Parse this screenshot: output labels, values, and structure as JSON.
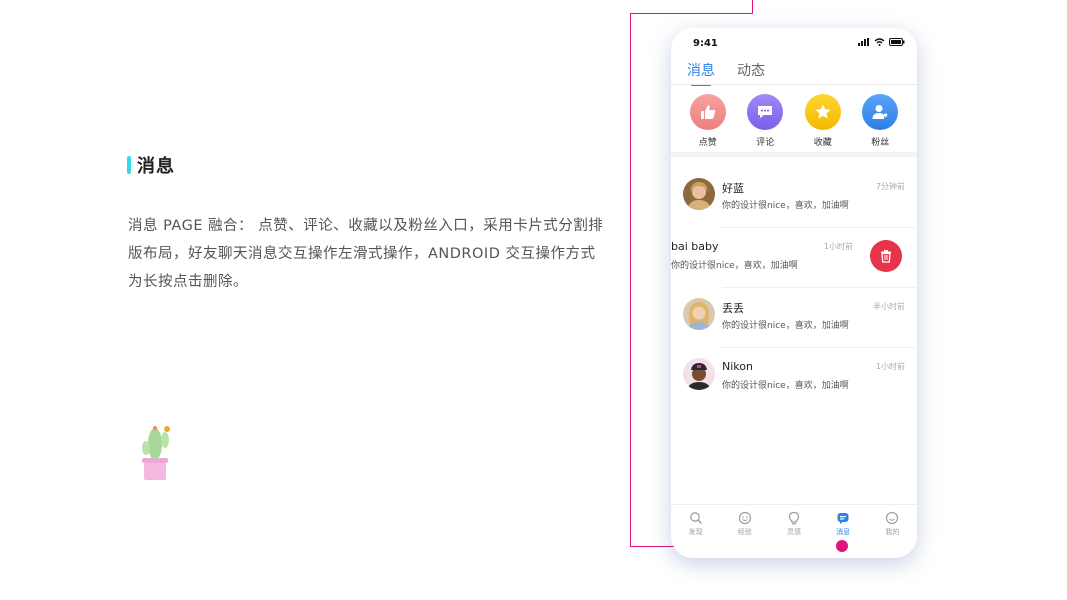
{
  "section": {
    "title": "消息",
    "description": "消息 PAGE 融合： 点赞、评论、收藏以及粉丝入口，采用卡片式分割排版布局，好友聊天消息交互操作左滑式操作，ANDROID 交互操作方式为长按点击删除。"
  },
  "phone": {
    "status_time": "9:41",
    "tabs": [
      {
        "label": "消息",
        "active": true
      },
      {
        "label": "动态",
        "active": false
      }
    ],
    "quick_actions": [
      {
        "label": "点赞",
        "icon": "thumbs-up-icon",
        "color": "#f28a8a"
      },
      {
        "label": "评论",
        "icon": "comment-icon",
        "color": "#8b6ef0"
      },
      {
        "label": "收藏",
        "icon": "star-icon",
        "color": "#f5c400"
      },
      {
        "label": "粉丝",
        "icon": "user-heart-icon",
        "color": "#3a8cf0"
      }
    ],
    "messages": [
      {
        "name": "好蓝",
        "text": "你的设计很nice，喜欢，加油啊",
        "time": "7分钟前"
      },
      {
        "name": "bai baby",
        "text": "你的设计很nice，喜欢，加油啊",
        "time": "1小时前"
      },
      {
        "name": "丢丢",
        "text": "你的设计很nice，喜欢，加油啊",
        "time": "半小时前"
      },
      {
        "name": "Nikon",
        "text": "你的设计很nice，喜欢，加油啊",
        "time": "1小时前"
      }
    ],
    "bottom_nav": [
      {
        "label": "发现",
        "icon": "search-icon"
      },
      {
        "label": "经验",
        "icon": "smile-icon"
      },
      {
        "label": "灵感",
        "icon": "bulb-icon"
      },
      {
        "label": "消息",
        "icon": "message-icon",
        "active": true
      },
      {
        "label": "我的",
        "icon": "profile-icon"
      }
    ],
    "accent_color": "#2c84e8",
    "delete_color": "#e8344a"
  }
}
